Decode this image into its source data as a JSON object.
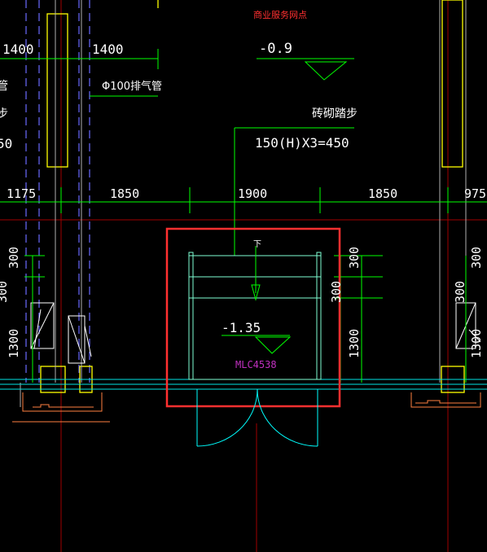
{
  "title": "商业服务网点",
  "pipe_label": "Φ100排气管",
  "step_label": "砖砌踏步",
  "step_spec": "150(H)X3=450",
  "elevation_top": "-0.9",
  "elevation_bottom": "-1.35",
  "door_code": "MLC4538",
  "down_arrow_label": "下",
  "dims_top": [
    "1400",
    "1400"
  ],
  "dims_row": [
    "1175",
    "1850",
    "1900",
    "1850",
    "975"
  ],
  "dims_vertical": [
    "300",
    "300",
    "1300",
    "300",
    "300",
    "1300",
    "300",
    "300",
    "1300"
  ],
  "left_edge_fragments": [
    "管",
    "步",
    "50"
  ],
  "colors": {
    "background": "#000000",
    "highlight_box": "#ff3030",
    "wall": "#ffff00",
    "dim_line": "#00ff00",
    "stair": "#7fffd4",
    "door": "#00ffff",
    "axis": "#a00000",
    "dashed": "#6a6aff",
    "foundation": "#ff8040"
  }
}
